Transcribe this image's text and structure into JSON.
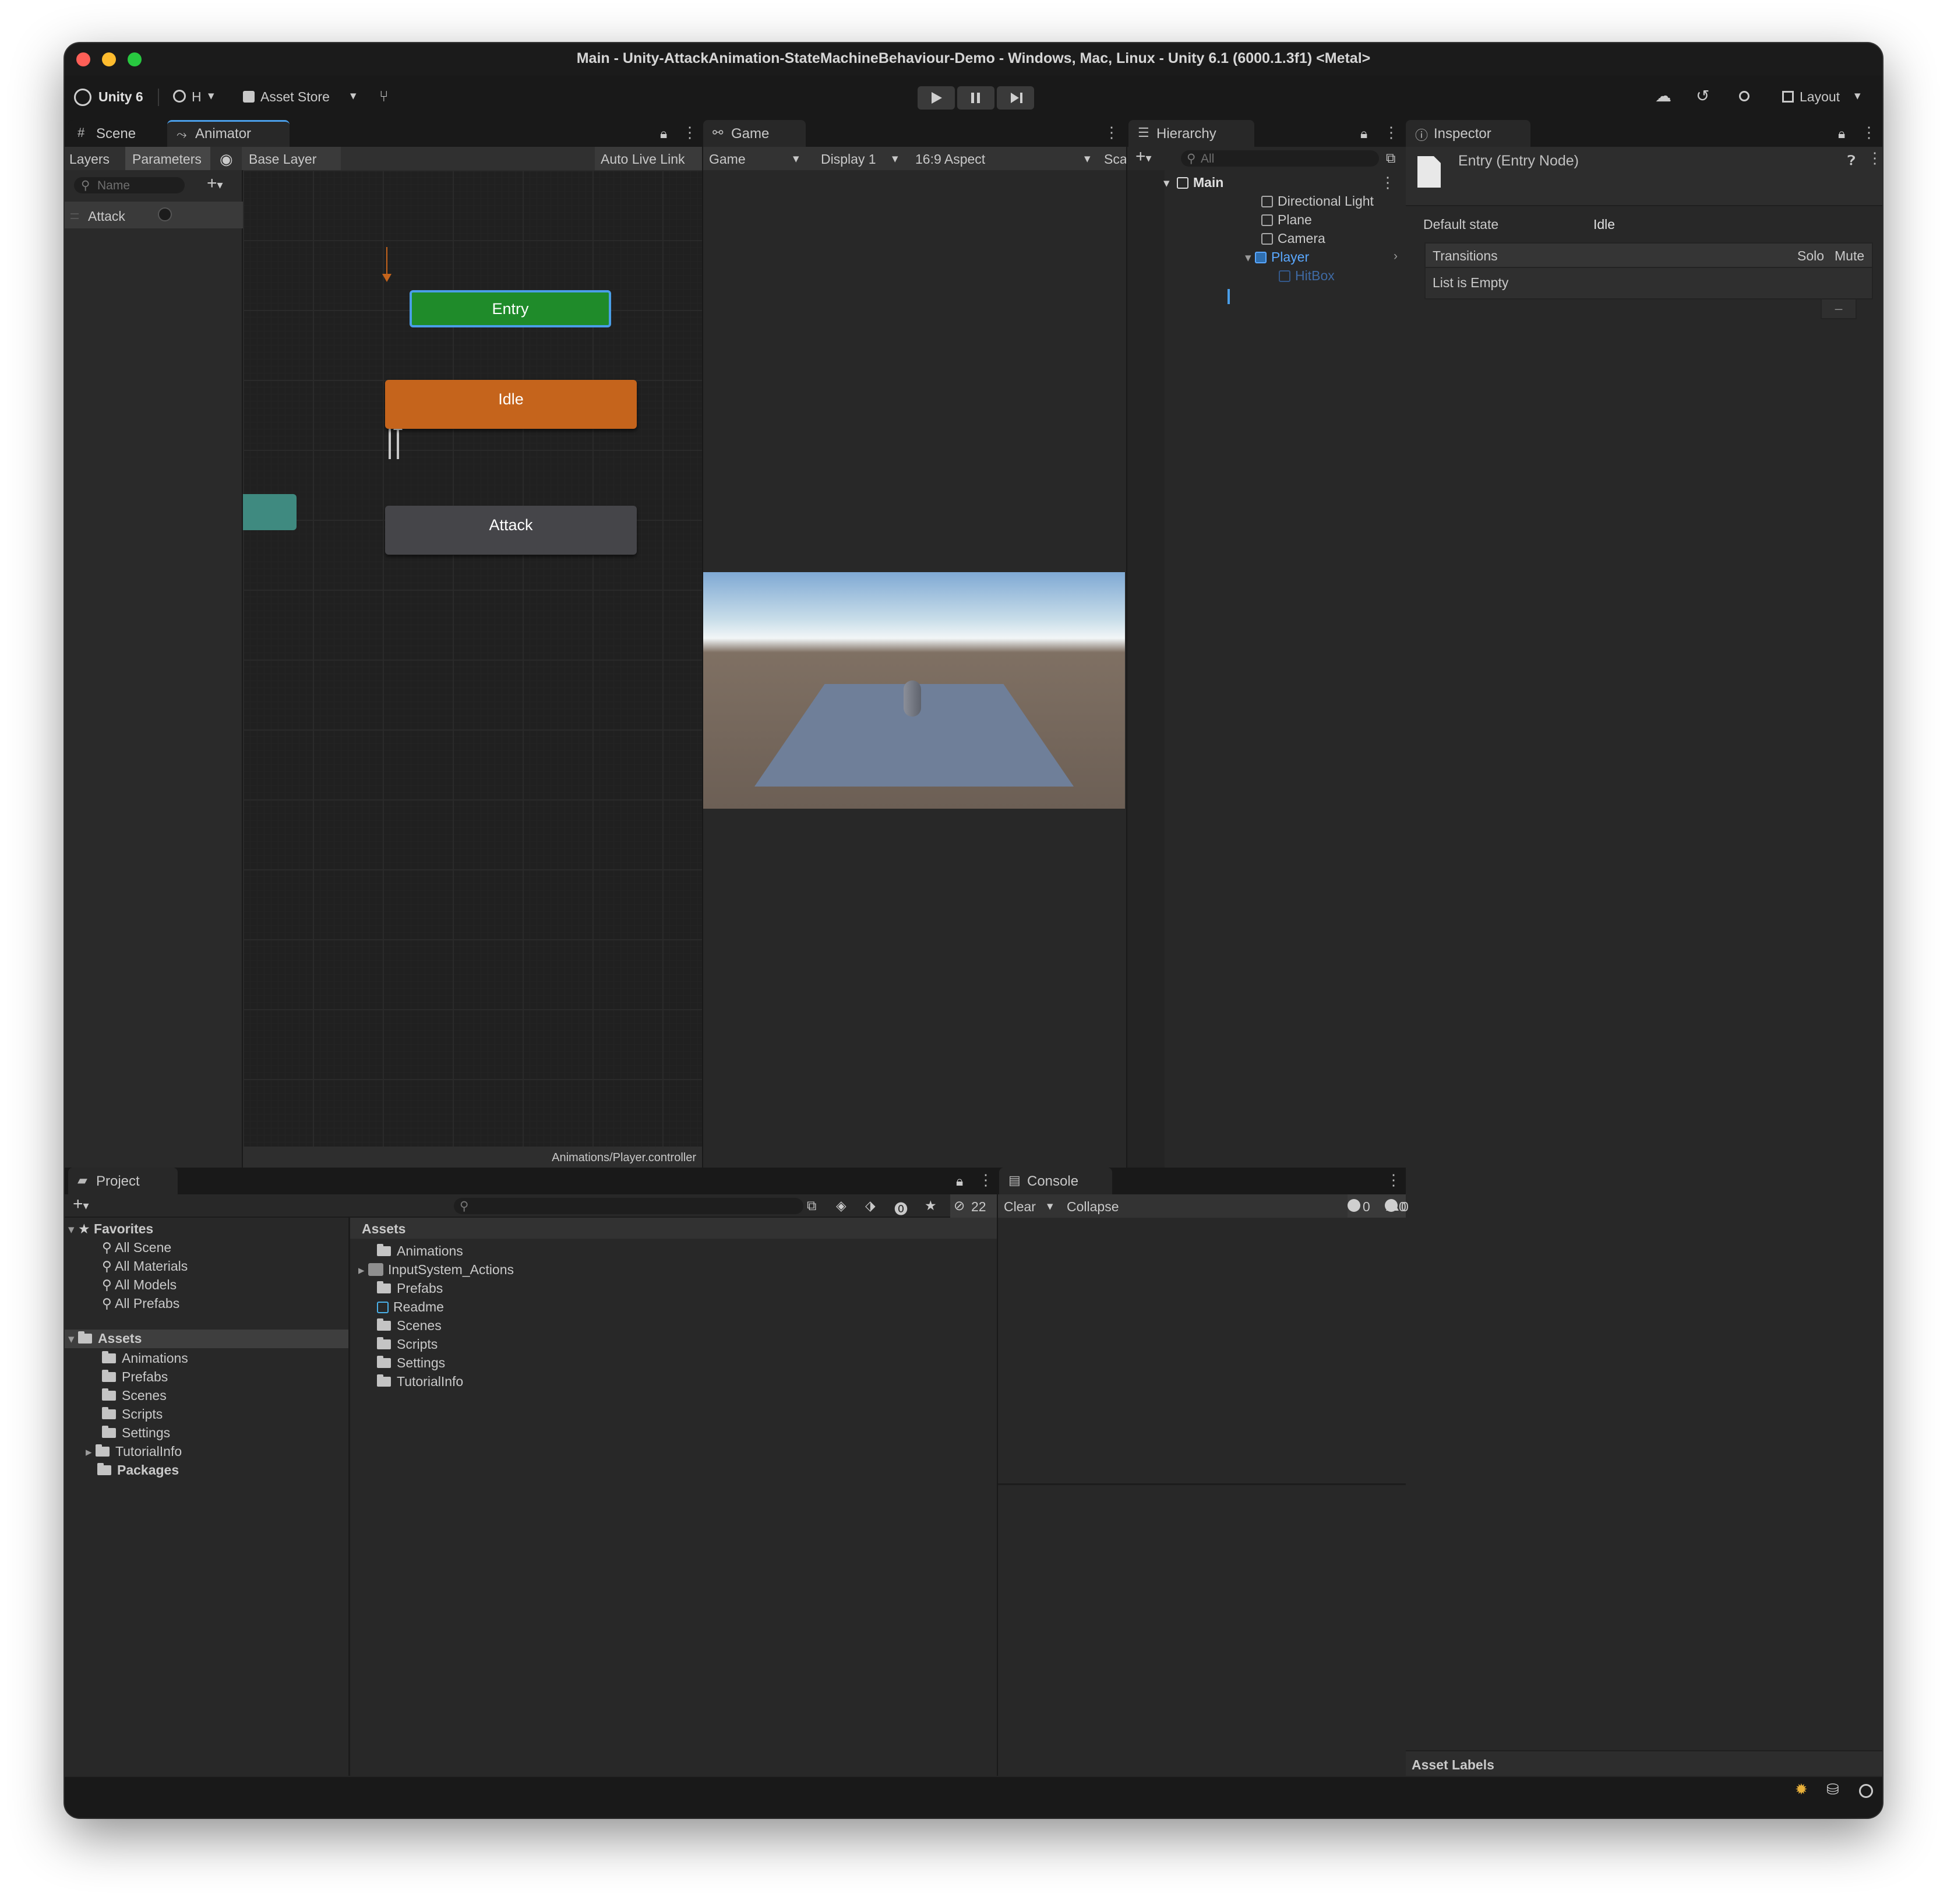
{
  "window": {
    "title": "Main - Unity-AttackAnimation-StateMachineBehaviour-Demo - Windows, Mac, Linux - Unity 6.1 (6000.1.3f1) <Metal>"
  },
  "toolbar": {
    "unity_label": "Unity 6",
    "account_label": "H",
    "asset_store_label": "Asset Store",
    "layout_label": "Layout"
  },
  "animator": {
    "tab_scene": "Scene",
    "tab_animator": "Animator",
    "subtab_layers": "Layers",
    "subtab_parameters": "Parameters",
    "breadcrumb": "Base Layer",
    "auto_live_link": "Auto Live Link",
    "search_placeholder": "Name",
    "parameters": [
      {
        "name": "Attack"
      }
    ],
    "nodes": {
      "entry": "Entry",
      "idle": "Idle",
      "attack": "Attack"
    },
    "footer_path": "Animations/Player.controller"
  },
  "game": {
    "tab": "Game",
    "mode": "Game",
    "display": "Display 1",
    "aspect": "16:9 Aspect",
    "scale_label": "Sca"
  },
  "hierarchy": {
    "tab": "Hierarchy",
    "search_placeholder": "All",
    "scene": "Main",
    "items": [
      "Directional Light",
      "Plane",
      "Camera",
      "Player"
    ],
    "child": "HitBox"
  },
  "inspector": {
    "tab": "Inspector",
    "title": "Entry (Entry Node)",
    "default_state_label": "Default state",
    "default_state_value": "Idle",
    "transitions_label": "Transitions",
    "solo": "Solo",
    "mute": "Mute",
    "list_empty": "List is Empty",
    "minus": "–",
    "asset_labels": "Asset Labels"
  },
  "project": {
    "tab": "Project",
    "hidden_count": "22",
    "favorites_label": "Favorites",
    "favorites": [
      "All Scene",
      "All Materials",
      "All Models",
      "All Prefabs"
    ],
    "assets_label": "Assets",
    "asset_folders": [
      "Animations",
      "Prefabs",
      "Scenes",
      "Scripts",
      "Settings",
      "TutorialInfo"
    ],
    "packages_label": "Packages",
    "grid_header": "Assets",
    "grid_items": [
      "Animations",
      "InputSystem_Actions",
      "Prefabs",
      "Readme",
      "Scenes",
      "Scripts",
      "Settings",
      "TutorialInfo"
    ]
  },
  "console": {
    "tab": "Console",
    "clear": "Clear",
    "collapse": "Collapse",
    "info_count": "0",
    "warn_count": "0",
    "error_count": "0"
  },
  "colors": {
    "entry_node": "#1f8b2a",
    "idle_node": "#c5641c",
    "attack_node": "#454549",
    "selection_blue": "#4a9ee8"
  }
}
